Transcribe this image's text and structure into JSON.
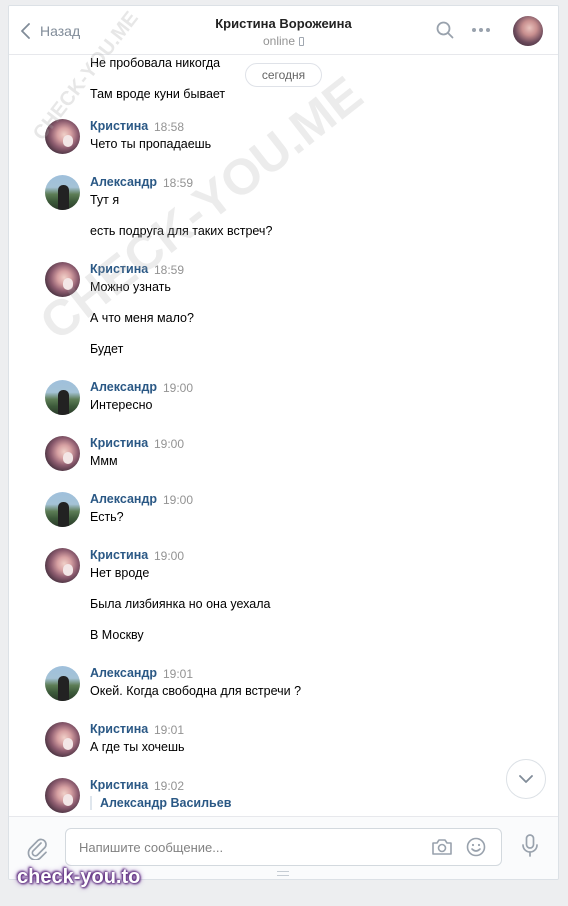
{
  "header": {
    "back_label": "Назад",
    "title": "Кристина Ворожеина",
    "status": "online"
  },
  "date_chip": "сегодня",
  "pre_lines": [
    "Не пробовала никогда",
    "Там вроде куни бывает"
  ],
  "messages": [
    {
      "author": "Кристина",
      "time": "18:58",
      "lines": [
        "Чето ты пропадаешь"
      ]
    },
    {
      "author": "Александр",
      "time": "18:59",
      "lines": [
        "Тут я",
        "есть подруга для таких встреч?"
      ]
    },
    {
      "author": "Кристина",
      "time": "18:59",
      "lines": [
        "Можно узнать",
        "А что меня мало?",
        "Будет"
      ]
    },
    {
      "author": "Александр",
      "time": "19:00",
      "lines": [
        "Интересно"
      ]
    },
    {
      "author": "Кристина",
      "time": "19:00",
      "lines": [
        "Ммм"
      ]
    },
    {
      "author": "Александр",
      "time": "19:00",
      "lines": [
        "Есть?"
      ]
    },
    {
      "author": "Кристина",
      "time": "19:00",
      "lines": [
        "Нет вроде",
        "Была лизбиянка но она уехала",
        "В Москву"
      ]
    },
    {
      "author": "Александр",
      "time": "19:01",
      "lines": [
        "Окей. Когда свободна для встречи ?"
      ]
    },
    {
      "author": "Кристина",
      "time": "19:01",
      "lines": [
        "А где ты хочешь"
      ]
    },
    {
      "author": "Кристина",
      "time": "19:02",
      "lines": [],
      "forwarded_from": "Александр Васильев"
    }
  ],
  "composer": {
    "placeholder": "Напишите сообщение..."
  },
  "watermarks": {
    "small": "CHECK-YOU.ME",
    "large": "CHECK-YOU.ME",
    "bottom": "check-you.to"
  },
  "icons": [
    "chevron-left-icon",
    "search-icon",
    "more-icon",
    "chevron-down-icon",
    "paperclip-icon",
    "camera-icon",
    "smile-icon",
    "microphone-icon",
    "phone-icon"
  ],
  "colors": {
    "link": "#2a5885",
    "muted": "#939393",
    "bg": "#edeef0"
  }
}
